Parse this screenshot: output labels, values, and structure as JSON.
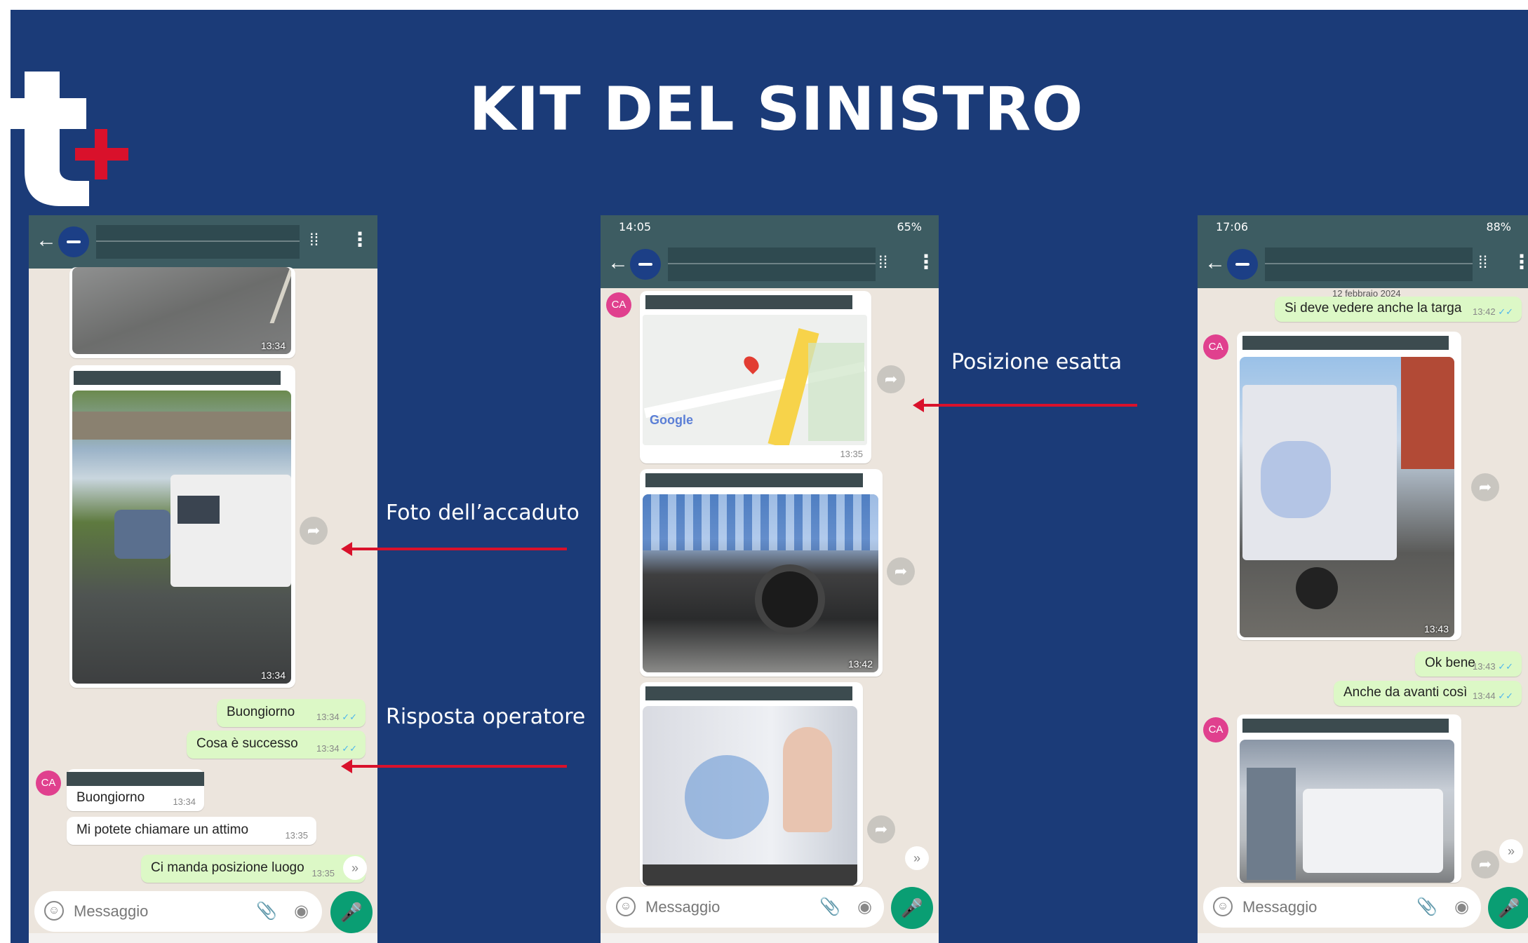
{
  "slide": {
    "title": "KIT DEL SINISTRO",
    "colors": {
      "background": "#1b3b78",
      "accent": "#d9112b",
      "whatsapp_header": "#3d5c62",
      "chat_bg": "#ece5dd",
      "outgoing": "#dcf8c6",
      "mic": "#0a9e73"
    }
  },
  "annotations": {
    "foto": "Foto dell’accaduto",
    "risposta": "Risposta operatore",
    "posizione": "Posizione esatta"
  },
  "phone1": {
    "img1_time": "13:34",
    "img2_time": "13:34",
    "msg_buongiorno": {
      "text": "Buongiorno",
      "time": "13:34",
      "ticks": "✓✓"
    },
    "msg_cosa": {
      "text": "Cosa è successo",
      "time": "13:34",
      "ticks": "✓✓"
    },
    "avatar": "CA",
    "msg_in_buongiorno": {
      "text": "Buongiorno",
      "time": "13:34"
    },
    "msg_in_chiamare": {
      "text": "Mi potete chiamare un attimo",
      "time": "13:35"
    },
    "msg_posizione": {
      "text": "Ci manda posizione luogo",
      "time": "13:35"
    },
    "input_placeholder": "Messaggio"
  },
  "phone2": {
    "status_left": "14:05",
    "status_right": "65%",
    "avatar": "CA",
    "map_time": "13:35",
    "map_brand": "Google",
    "img2_time": "13:42",
    "input_placeholder": "Messaggio"
  },
  "phone3": {
    "status_left": "17:06",
    "status_right": "88%",
    "date_chip": "12 febbraio 2024",
    "msg_targa": {
      "text": "Si deve vedere anche la targa",
      "time": "13:42",
      "ticks": "✓✓"
    },
    "avatar": "CA",
    "img1_time": "13:43",
    "msg_okbene": {
      "text": "Ok bene",
      "time": "13:43",
      "ticks": "✓✓"
    },
    "msg_anche": {
      "text": "Anche da avanti così",
      "time": "13:44",
      "ticks": "✓✓"
    },
    "input_placeholder": "Messaggio"
  },
  "icons": [
    "back-arrow-icon",
    "avatar-icon",
    "audio-wave-icon",
    "kebab-menu-icon",
    "forward-icon",
    "emoji-icon",
    "attach-icon",
    "camera-icon",
    "mic-icon",
    "scroll-down-icon"
  ]
}
